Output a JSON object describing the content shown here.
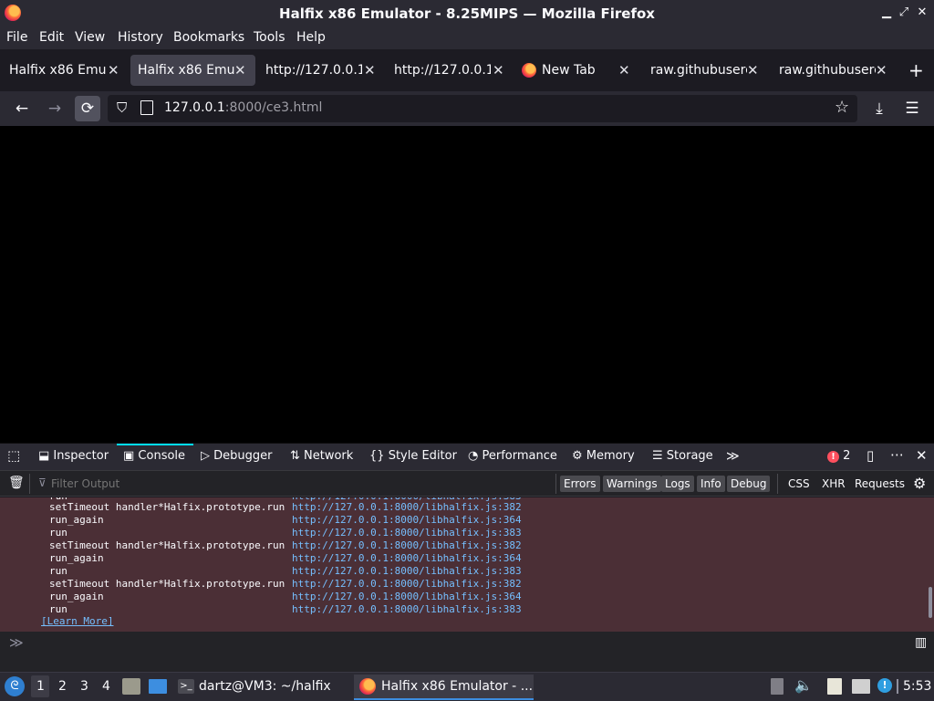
{
  "window": {
    "title": "Halfix x86 Emulator - 8.25MIPS — Mozilla Firefox"
  },
  "menu": [
    "File",
    "Edit",
    "View",
    "History",
    "Bookmarks",
    "Tools",
    "Help"
  ],
  "tabs": [
    {
      "label": "Halfix x86 Emul"
    },
    {
      "label": "Halfix x86 Emul"
    },
    {
      "label": "http://127.0.0.1"
    },
    {
      "label": "http://127.0.0.1"
    },
    {
      "label": "New Tab"
    },
    {
      "label": "raw.githubuserc"
    },
    {
      "label": "raw.githubuserc"
    }
  ],
  "url": {
    "host": "127.0.0.1",
    "rest": ":8000/ce3.html"
  },
  "devtools": {
    "tabs": [
      "Inspector",
      "Console",
      "Debugger",
      "Network",
      "Style Editor",
      "Performance",
      "Memory",
      "Storage"
    ],
    "error_count": "2",
    "filter_placeholder": "Filter Output",
    "filters": [
      "Errors",
      "Warnings",
      "Logs",
      "Info",
      "Debug"
    ],
    "extra_filters": [
      "CSS",
      "XHR",
      "Requests"
    ]
  },
  "stack": [
    {
      "fn": "setTimeout handler*Halfix.prototype.run",
      "loc": "http://127.0.0.1:8000/libhalfix.js:382"
    },
    {
      "fn": "run_again",
      "loc": "http://127.0.0.1:8000/libhalfix.js:364"
    },
    {
      "fn": "run",
      "loc": "http://127.0.0.1:8000/libhalfix.js:383"
    },
    {
      "fn": "setTimeout handler*Halfix.prototype.run",
      "loc": "http://127.0.0.1:8000/libhalfix.js:382"
    },
    {
      "fn": "run_again",
      "loc": "http://127.0.0.1:8000/libhalfix.js:364"
    },
    {
      "fn": "run",
      "loc": "http://127.0.0.1:8000/libhalfix.js:383"
    },
    {
      "fn": "setTimeout handler*Halfix.prototype.run",
      "loc": "http://127.0.0.1:8000/libhalfix.js:382"
    },
    {
      "fn": "run_again",
      "loc": "http://127.0.0.1:8000/libhalfix.js:364"
    },
    {
      "fn": "run",
      "loc": "http://127.0.0.1:8000/libhalfix.js:383"
    }
  ],
  "learn_more": "[Learn More]",
  "taskbar": {
    "workspaces": [
      "1",
      "2",
      "3",
      "4"
    ],
    "terminal": "dartz@VM3: ~/halfix",
    "firefox": "Halfix x86 Emulator - ...",
    "clock": "5:53"
  }
}
